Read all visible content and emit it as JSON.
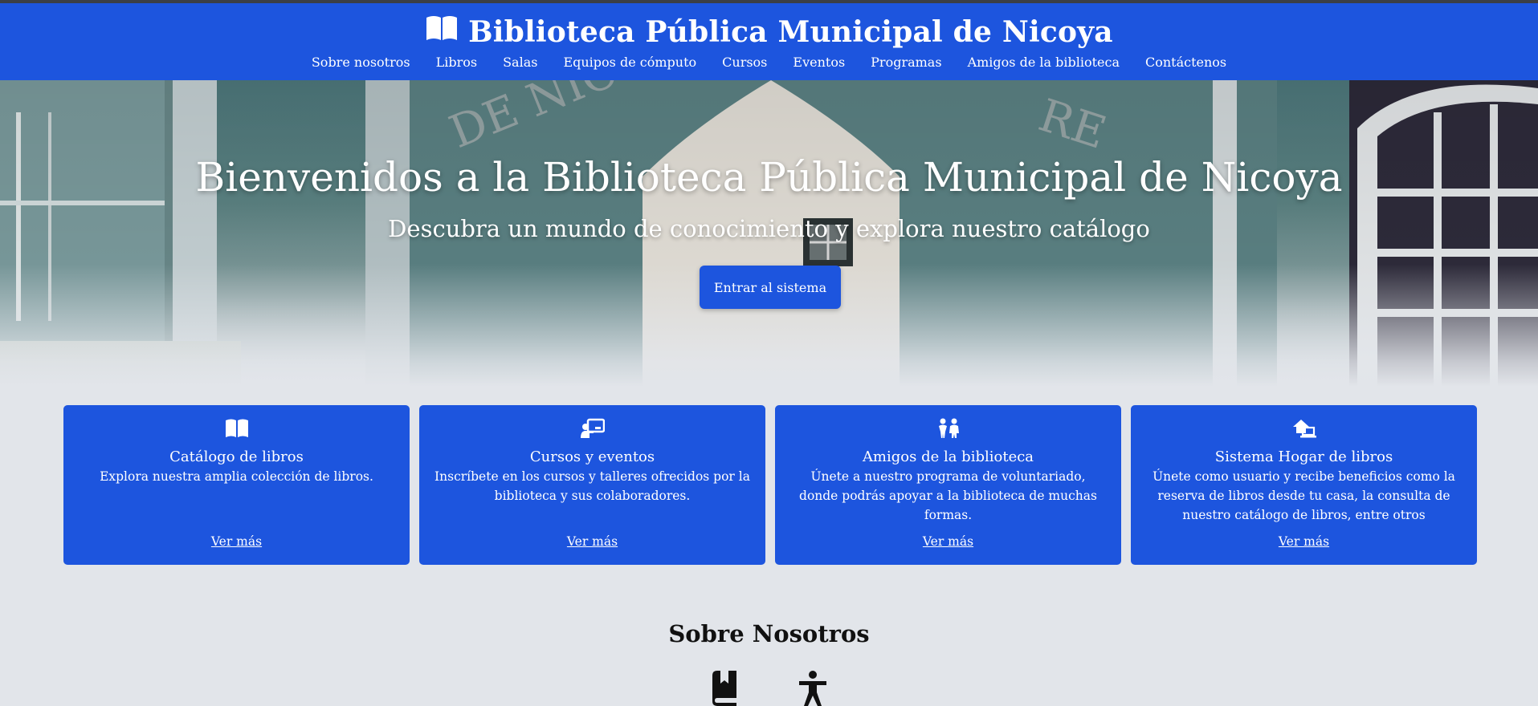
{
  "header": {
    "title": "Biblioteca Pública Municipal de Nicoya",
    "nav": [
      "Sobre nosotros",
      "Libros",
      "Salas",
      "Equipos de cómputo",
      "Cursos",
      "Eventos",
      "Programas",
      "Amigos de la biblioteca",
      "Contáctenos"
    ]
  },
  "hero": {
    "title": "Bienvenidos a la Biblioteca Pública Municipal de Nicoya",
    "subtitle": "Descubra un mundo de conocimiento y explora nuestro catálogo",
    "button": "Entrar al sistema"
  },
  "cards": [
    {
      "icon": "book-open-icon",
      "title": "Catálogo de libros",
      "description": "Explora nuestra amplia colección de libros.",
      "link": "Ver más"
    },
    {
      "icon": "chalkboard-teacher-icon",
      "title": "Cursos y eventos",
      "description": "Inscríbete en los cursos y talleres ofrecidos por la biblioteca y sus colaboradores.",
      "link": "Ver más"
    },
    {
      "icon": "children-icon",
      "title": "Amigos de la biblioteca",
      "description": "Únete a nuestro programa de voluntariado, donde podrás apoyar a la biblioteca de muchas formas.",
      "link": "Ver más"
    },
    {
      "icon": "house-laptop-icon",
      "title": "Sistema Hogar de libros",
      "description": "Únete como usuario y recibe beneficios como la reserva de libros desde tu casa, la consulta de nuestro catálogo de libros, entre otros",
      "link": "Ver más"
    }
  ],
  "about": {
    "title": "Sobre Nosotros",
    "icons": [
      "book-bookmark-icon",
      "universal-access-icon"
    ]
  },
  "colors": {
    "primary": "#1d55de",
    "background": "#e2e5ea",
    "text_on_primary": "#ffffff"
  }
}
